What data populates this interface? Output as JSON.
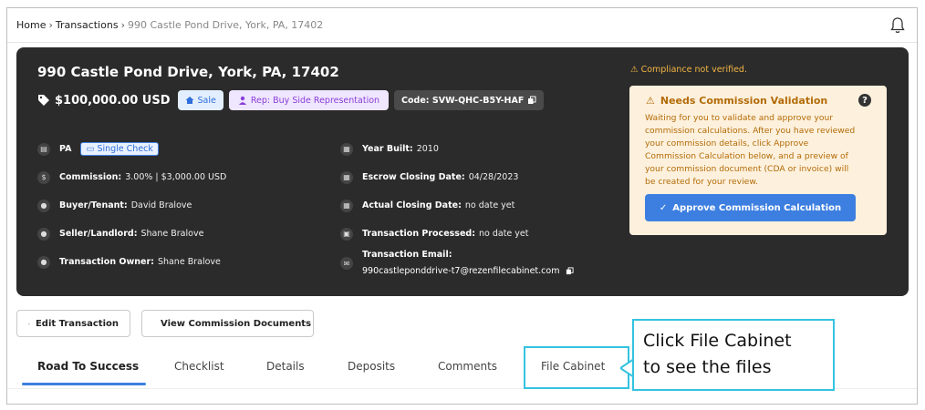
{
  "breadcrumb": {
    "home": "Home",
    "transactions": "Transactions",
    "current": "990 Castle Pond Drive, York, PA, 17402"
  },
  "header": {
    "address": "990 Castle Pond Drive, York, PA, 17402",
    "price": "$100,000.00 USD",
    "sale_badge": "Sale",
    "rep_badge": "Rep: Buy Side Representation",
    "code_badge": "Code: SVW-QHC-B5Y-HAF"
  },
  "details_left": {
    "state": "PA",
    "single_check": "Single Check",
    "commission_label": "Commission:",
    "commission_value": "3.00% | $3,000.00 USD",
    "buyer_label": "Buyer/Tenant:",
    "buyer_value": "David Bralove",
    "seller_label": "Seller/Landlord:",
    "seller_value": "Shane Bralove",
    "owner_label": "Transaction Owner:",
    "owner_value": "Shane Bralove"
  },
  "details_mid": {
    "year_label": "Year Built:",
    "year_value": "2010",
    "escrow_label": "Escrow Closing Date:",
    "escrow_value": "04/28/2023",
    "actual_label": "Actual Closing Date:",
    "actual_value": "no date yet",
    "processed_label": "Transaction Processed:",
    "processed_value": "no date yet",
    "email_label": "Transaction Email:",
    "email_value": "990castleponddrive-t7@rezenfilecabinet.com"
  },
  "compliance": {
    "text": "Compliance not verified."
  },
  "validation": {
    "title": "Needs Commission Validation",
    "help": "?",
    "body": "Waiting for you to validate and approve your commission calculations. After you have reviewed your commission details, click Approve Commission Calculation below, and a preview of your commission document (CDA or invoice) will be created for your review.",
    "approve_button": "Approve Commission Calculation"
  },
  "actions": {
    "edit": "Edit Transaction",
    "view_docs": "View Commission Documents"
  },
  "tabs": [
    {
      "label": "Road To Success"
    },
    {
      "label": "Checklist"
    },
    {
      "label": "Details"
    },
    {
      "label": "Deposits"
    },
    {
      "label": "Comments"
    },
    {
      "label": "File Cabinet"
    }
  ],
  "callout": {
    "line1": "Click File Cabinet",
    "line2": "to see the files"
  },
  "colors": {
    "accent_blue": "#3d7fe0",
    "card_bg": "#2b2b2b",
    "warning_bg": "#fdf1dd",
    "warning_text": "#b36b08",
    "callout_border": "#34c3e0"
  }
}
